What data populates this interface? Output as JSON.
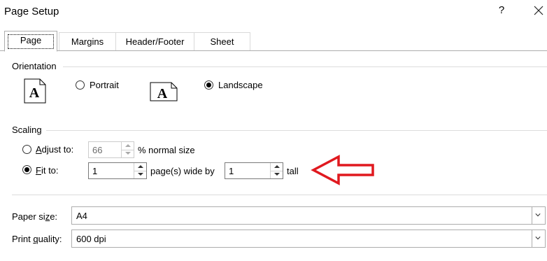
{
  "window": {
    "title": "Page Setup",
    "help": "?",
    "close_icon": "close-icon"
  },
  "tabs": [
    {
      "label": "Page",
      "active": true
    },
    {
      "label": "Margins",
      "active": false
    },
    {
      "label": "Header/Footer",
      "active": false
    },
    {
      "label": "Sheet",
      "active": false
    }
  ],
  "orientation": {
    "label": "Orientation",
    "portrait": {
      "label": "Portrait",
      "checked": false,
      "icon": "portrait-page-icon",
      "glyph": "A"
    },
    "landscape": {
      "label": "Landscape",
      "checked": true,
      "icon": "landscape-page-icon",
      "glyph": "A"
    }
  },
  "scaling": {
    "label": "Scaling",
    "adjust_to": {
      "label_u": "A",
      "label_rest": "djust to:",
      "checked": false,
      "value": "66",
      "suffix": "% normal size"
    },
    "fit_to": {
      "label_u": "F",
      "label_rest": "it to:",
      "checked": true,
      "wide_value": "1",
      "wide_suffix": "page(s) wide by",
      "tall_value": "1",
      "tall_suffix": "tall"
    }
  },
  "annotation": {
    "arrow_color": "#e0191f"
  },
  "paper_size": {
    "label_pre": "Paper si",
    "label_u": "z",
    "label_post": "e:",
    "value": "A4"
  },
  "print_quality": {
    "label_pre": "Print ",
    "label_u": "q",
    "label_post": "uality:",
    "value": "600 dpi"
  }
}
